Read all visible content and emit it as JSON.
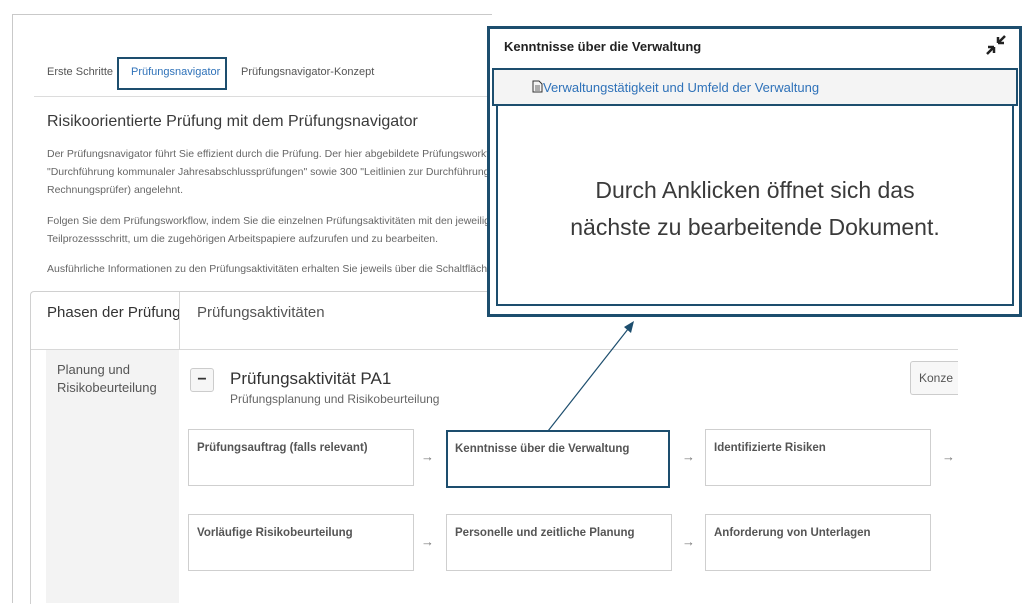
{
  "tabs": [
    {
      "label": "Erste Schritte"
    },
    {
      "label": "Prüfungsnavigator"
    },
    {
      "label": "Prüfungsnavigator-Konzept"
    }
  ],
  "page": {
    "title": "Risikoorientierte Prüfung mit dem Prüfungsnavigator",
    "paragraphs": [
      "Der Prüfungsnavigator führt Sie effizient durch die Prüfung. Der hier abgebildete Prüfungsworkfl",
      "\"Durchführung kommunaler Jahresabschlussprüfungen\" sowie 300 \"Leitlinien zur Durchführung",
      "Rechnungsprüfer) angelehnt.",
      "Folgen Sie dem Prüfungsworkflow, indem Sie die einzelnen Prüfungsaktivitäten mit den jeweilig",
      "Teilprozessschritt, um die zugehörigen Arbeitspapiere aufzurufen und zu bearbeiten.",
      "Ausführliche Informationen zu den Prüfungsaktivitäten erhalten Sie jeweils über die Schaltfläche"
    ]
  },
  "table": {
    "phase_header": "Phasen der Prüfung",
    "activity_header": "Prüfungsaktivitäten",
    "phase_name": "Planung und\nRisikobeurteilung",
    "collapse_symbol": "−",
    "activity_title": "Prüfungsaktivität PA1",
    "activity_subtitle": "Prüfungsplanung und Risikobeurteilung",
    "konzept_button": "Konze",
    "steps": [
      {
        "label": "Prüfungsauftrag (falls relevant)"
      },
      {
        "label": "Kenntnisse über die Verwaltung"
      },
      {
        "label": "Identifizierte Risiken"
      },
      {
        "label": "Vorläufige Risikobeurteilung"
      },
      {
        "label": "Personelle und zeitliche Planung"
      },
      {
        "label": "Anforderung von Unterlagen"
      }
    ],
    "arrow_symbol": "→"
  },
  "popup": {
    "title": "Kenntnisse über die Verwaltung",
    "collapse_icon": "collapse-arrows-icon",
    "link_text": "Verwaltungstätigkeit und Umfeld der Verwaltung",
    "message_line1": "Durch Anklicken öffnet sich das",
    "message_line2": "nächste zu bearbeitende Dokument."
  },
  "colors": {
    "highlight_border": "#1d4e6e",
    "link": "#2f72b9"
  }
}
